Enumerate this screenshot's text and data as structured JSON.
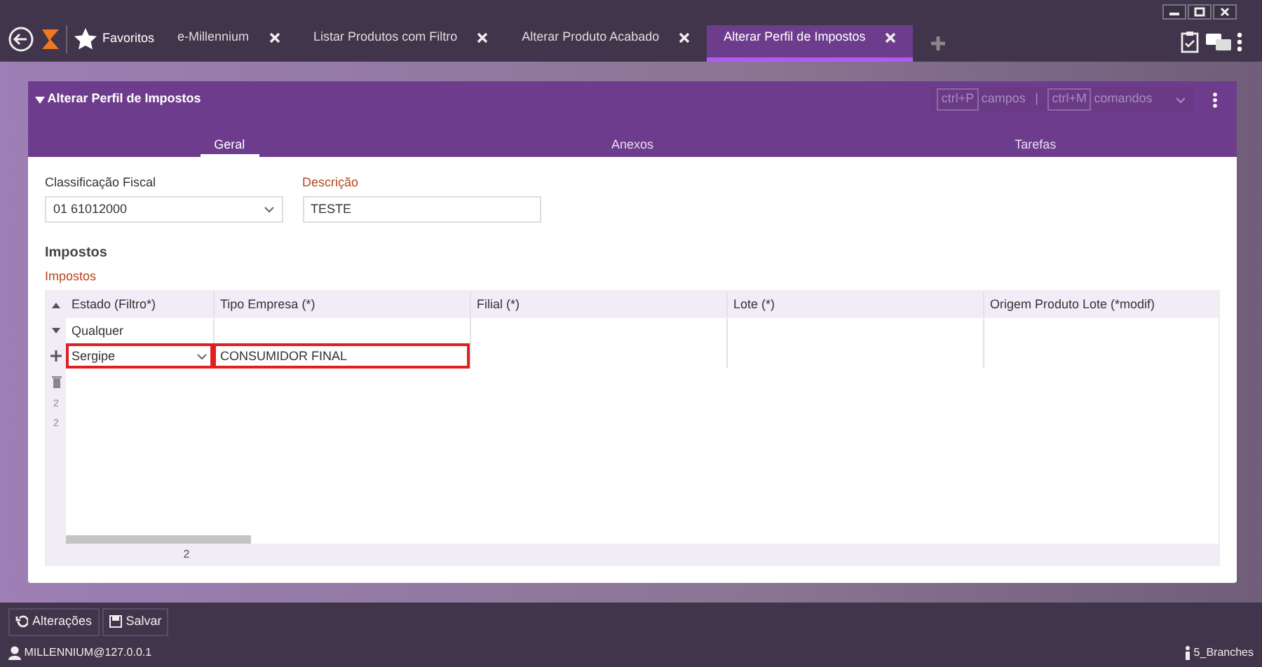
{
  "tabs": [
    {
      "label": "e-Millennium",
      "selected": false
    },
    {
      "label": "Listar Produtos com Filtro",
      "selected": false
    },
    {
      "label": "Alterar Produto Acabado",
      "selected": false
    },
    {
      "label": "Alterar Perfil de Impostos",
      "selected": true
    }
  ],
  "favorites": "Favoritos",
  "panel": {
    "title": "Alterar Perfil de Impostos",
    "shortcuts": [
      {
        "key": "ctrl+P",
        "label": "campos"
      },
      {
        "key": "ctrl+M",
        "label": "comandos"
      }
    ],
    "separator": "|",
    "subtabs": [
      {
        "label": "Geral",
        "selected": true
      },
      {
        "label": "Anexos",
        "selected": false
      },
      {
        "label": "Tarefas",
        "selected": false
      }
    ],
    "fields": [
      {
        "label": "Classificação Fiscal",
        "value": "01 61012000",
        "kind": "select",
        "required": false
      },
      {
        "label": "Descrição",
        "value": "TESTE",
        "kind": "text",
        "required": true
      }
    ],
    "section": "Impostos",
    "grid_label": "Impostos",
    "grid": {
      "columns": [
        "Estado (Filtro*)",
        "Tipo Empresa (*)",
        "Filial (*)",
        "Lote (*)",
        "Origem Produto Lote (*modif)"
      ],
      "rows": [
        {
          "cells": [
            "Qualquer"
          ],
          "highlighted": false,
          "kind": "text"
        },
        {
          "cells": [
            "Sergipe",
            "CONSUMIDOR FINAL"
          ],
          "highlighted": true,
          "kind": "select"
        }
      ],
      "side_numbers": [
        "2",
        "2"
      ],
      "footer": "2"
    }
  },
  "bottom_buttons": [
    "Alterações",
    "Salvar"
  ],
  "status": {
    "user": "MILLENNIUM@127.0.0.1",
    "branch": "5_Branches"
  }
}
